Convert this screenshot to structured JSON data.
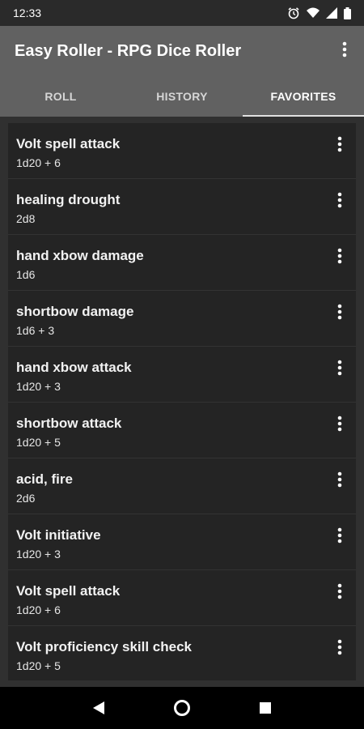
{
  "status_bar": {
    "time": "12:33",
    "icons": [
      "alarm-icon",
      "wifi-icon",
      "signal-icon",
      "battery-icon"
    ]
  },
  "app_bar": {
    "title": "Easy Roller - RPG Dice Roller",
    "overflow_icon": "more-vertical-icon"
  },
  "tabs": [
    {
      "label": "ROLL",
      "active": false
    },
    {
      "label": "HISTORY",
      "active": false
    },
    {
      "label": "FAVORITES",
      "active": true
    }
  ],
  "favorites": [
    {
      "name": "Volt spell attack",
      "formula": "1d20 + 6"
    },
    {
      "name": "healing drought",
      "formula": "2d8"
    },
    {
      "name": "hand xbow damage",
      "formula": "1d6"
    },
    {
      "name": "shortbow damage",
      "formula": "1d6 + 3"
    },
    {
      "name": "hand xbow attack",
      "formula": "1d20 + 3"
    },
    {
      "name": "shortbow attack",
      "formula": "1d20 + 5"
    },
    {
      "name": "acid, fire",
      "formula": "2d6"
    },
    {
      "name": "Volt initiative",
      "formula": "1d20 + 3"
    },
    {
      "name": "Volt spell attack",
      "formula": "1d20 + 6"
    },
    {
      "name": "Volt proficiency skill check",
      "formula": "1d20 + 5"
    }
  ],
  "nav_bar": {
    "buttons": [
      "back-icon",
      "home-icon",
      "recents-icon"
    ]
  },
  "colors": {
    "background": "#303030",
    "app_bar": "#616161",
    "list_bg": "#242424",
    "nav_bar": "#000000"
  }
}
